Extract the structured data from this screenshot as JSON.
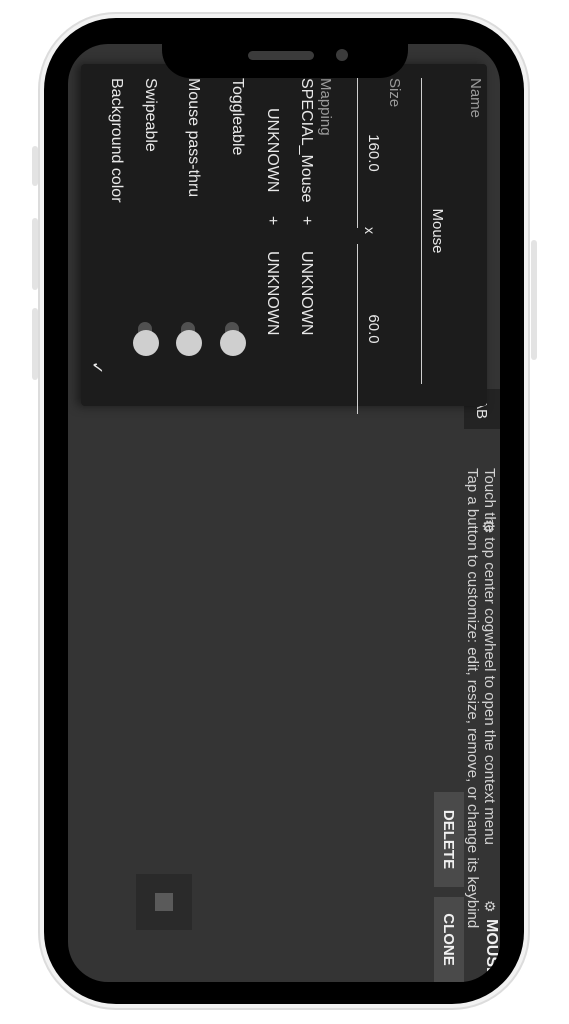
{
  "panel": {
    "name_label": "Name",
    "name_value": "Mouse",
    "size_label": "Size",
    "size_width": "160.0",
    "size_separator": "x",
    "size_height": "60.0",
    "mapping_label": "Mapping",
    "mapping_row1": [
      "SPECIAL_Mouse",
      "+",
      "UNKNOWN"
    ],
    "mapping_row2": [
      "UNKNOWN",
      "+",
      "UNKNOWN"
    ],
    "toggleable_label": "Toggleable",
    "passthru_label": "Mouse pass-thru",
    "swipeable_label": "Swipeable",
    "bgcolor_label": "Background color",
    "check_mark": "✓"
  },
  "top": {
    "tab_label": "AB",
    "mouse_label": "MOUSE"
  },
  "help": {
    "line1": "Touch the top center cogwheel to open the context menu",
    "line2": "Tap a button to customize: edit, resize, remove, or change its keybind"
  },
  "buttons": {
    "delete": "DELETE",
    "clone": "CLONE"
  },
  "toggles": {
    "toggleable": false,
    "mouse_passthru": false,
    "swipeable": false
  }
}
